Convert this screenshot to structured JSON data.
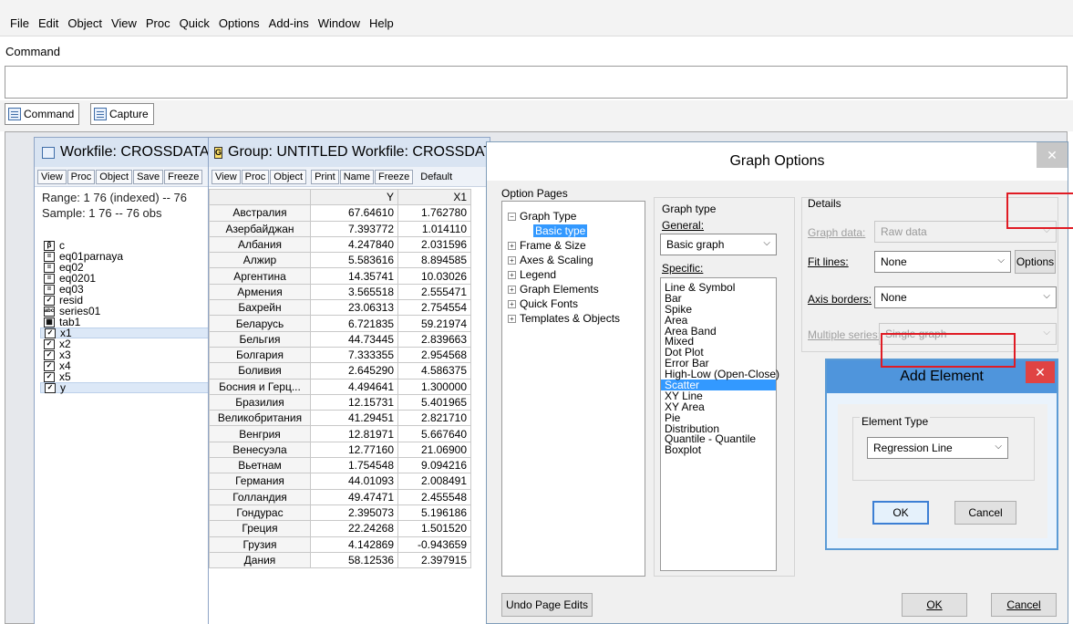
{
  "menu": [
    "File",
    "Edit",
    "Object",
    "View",
    "Proc",
    "Quick",
    "Options",
    "Add-ins",
    "Window",
    "Help"
  ],
  "command_label": "Command",
  "cmd_tabs": [
    "Command",
    "Capture"
  ],
  "workfile": {
    "title": "Workfile: CROSSDATA",
    "toolbar": [
      "View",
      "Proc",
      "Object",
      "Save",
      "Freeze"
    ],
    "range": "Range: 1 76 (indexed)  --  76",
    "sample": "Sample: 1 76  --  76 obs",
    "objects": [
      {
        "icon": "coef-icon",
        "glyph": "β",
        "name": "c"
      },
      {
        "icon": "equation-icon",
        "glyph": "=",
        "name": "eq01parnaya"
      },
      {
        "icon": "equation-icon",
        "glyph": "=",
        "name": "eq02"
      },
      {
        "icon": "equation-icon",
        "glyph": "=",
        "name": "eq0201"
      },
      {
        "icon": "equation-icon",
        "glyph": "=",
        "name": "eq03"
      },
      {
        "icon": "series-icon",
        "glyph": "✓",
        "name": "resid"
      },
      {
        "icon": "alpha-series-icon",
        "glyph": "abc",
        "name": "series01"
      },
      {
        "icon": "table-icon",
        "glyph": "▦",
        "name": "tab1"
      },
      {
        "icon": "series-icon",
        "glyph": "✓",
        "name": "x1",
        "selected": true
      },
      {
        "icon": "series-icon",
        "glyph": "✓",
        "name": "x2"
      },
      {
        "icon": "series-icon",
        "glyph": "✓",
        "name": "x3"
      },
      {
        "icon": "series-icon",
        "glyph": "✓",
        "name": "x4"
      },
      {
        "icon": "series-icon",
        "glyph": "✓",
        "name": "x5"
      },
      {
        "icon": "series-icon",
        "glyph": "✓",
        "name": "y",
        "selected": true
      }
    ]
  },
  "group": {
    "title": "Group: UNTITLED   Workfile: CROSSDATA",
    "toolbar": [
      "View",
      "Proc",
      "Object",
      "Print",
      "Name",
      "Freeze",
      "Default"
    ],
    "columns": [
      "",
      "Y",
      "X1"
    ],
    "rows": [
      [
        "Австралия",
        "67.64610",
        "1.762780"
      ],
      [
        "Азербайджан",
        "7.393772",
        "1.014110"
      ],
      [
        "Албания",
        "4.247840",
        "2.031596"
      ],
      [
        "Алжир",
        "5.583616",
        "8.894585"
      ],
      [
        "Аргентина",
        "14.35741",
        "10.03026"
      ],
      [
        "Армения",
        "3.565518",
        "2.555471"
      ],
      [
        "Бахрейн",
        "23.06313",
        "2.754554"
      ],
      [
        "Беларусь",
        "6.721835",
        "59.21974"
      ],
      [
        "Бельгия",
        "44.73445",
        "2.839663"
      ],
      [
        "Болгария",
        "7.333355",
        "2.954568"
      ],
      [
        "Боливия",
        "2.645290",
        "4.586375"
      ],
      [
        "Босния и Герц...",
        "4.494641",
        "1.300000"
      ],
      [
        "Бразилия",
        "12.15731",
        "5.401965"
      ],
      [
        "Великобритания",
        "41.29451",
        "2.821710"
      ],
      [
        "Венгрия",
        "12.81971",
        "5.667640"
      ],
      [
        "Венесуэла",
        "12.77160",
        "21.06900"
      ],
      [
        "Вьетнам",
        "1.754548",
        "9.094216"
      ],
      [
        "Германия",
        "44.01093",
        "2.008491"
      ],
      [
        "Голландия",
        "49.47471",
        "2.455548"
      ],
      [
        "Гондурас",
        "2.395073",
        "5.196186"
      ],
      [
        "Греция",
        "22.24268",
        "1.501520"
      ],
      [
        "Грузия",
        "4.142869",
        "-0.943659"
      ],
      [
        "Дания",
        "58.12536",
        "2.397915"
      ]
    ]
  },
  "graph_options": {
    "title": "Graph Options",
    "option_pages_label": "Option Pages",
    "tree": [
      {
        "label": "Graph Type",
        "sign": "⊟"
      },
      {
        "label": "Basic type",
        "child": true,
        "selected": true
      },
      {
        "label": "Frame & Size",
        "sign": "⊞"
      },
      {
        "label": "Axes & Scaling",
        "sign": "⊞"
      },
      {
        "label": "Legend",
        "sign": "⊞"
      },
      {
        "label": "Graph Elements",
        "sign": "⊞"
      },
      {
        "label": "Quick Fonts",
        "sign": "⊞"
      },
      {
        "label": "Templates & Objects",
        "sign": "⊞"
      }
    ],
    "graph_type_label": "Graph type",
    "general_label": "General:",
    "general_value": "Basic graph",
    "specific_label": "Specific:",
    "specific": [
      "Line & Symbol",
      "Bar",
      "Spike",
      "Area",
      "Area Band",
      "Mixed",
      "Dot Plot",
      "Error Bar",
      "High-Low (Open-Close)",
      "Scatter",
      "XY Line",
      "XY Area",
      "Pie",
      "Distribution",
      "Quantile - Quantile",
      "Boxplot"
    ],
    "specific_selected": "Scatter",
    "details_label": "Details",
    "graph_data_label": "Graph data:",
    "graph_data_value": "Raw data",
    "fit_lines_label": "Fit lines:",
    "fit_lines_value": "None",
    "options_button": "Options",
    "axis_borders_label": "Axis borders:",
    "axis_borders_value": "None",
    "multiple_series_label": "Multiple series:",
    "multiple_series_value": "Single graph",
    "undo_button": "Undo Page Edits",
    "ok_button": "OK",
    "cancel_button": "Cancel"
  },
  "add_element": {
    "title": "Add Element",
    "element_type_label": "Element Type",
    "element_type_value": "Regression Line",
    "ok_button": "OK",
    "cancel_button": "Cancel"
  }
}
